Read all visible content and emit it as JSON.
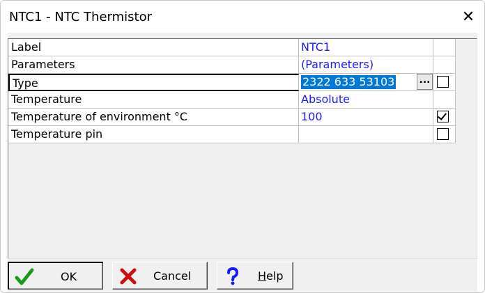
{
  "window": {
    "title": "NTC1 - NTC Thermistor",
    "close_glyph": "✕"
  },
  "properties": [
    {
      "name": "Label",
      "value": "NTC1",
      "checkbox": null
    },
    {
      "name": "Parameters",
      "value": "(Parameters)",
      "checkbox": null
    },
    {
      "name": "Type",
      "value": "2322 633 53103",
      "checkbox": false,
      "selected": true,
      "has_ellipsis": true
    },
    {
      "name": "Temperature",
      "value": "Absolute",
      "checkbox": null
    },
    {
      "name": "Temperature of environment °C",
      "value": "100",
      "checkbox": true
    },
    {
      "name": "Temperature pin",
      "value": "",
      "checkbox": false
    }
  ],
  "ellipsis_label": "...",
  "buttons": {
    "ok_label": "OK",
    "cancel_label": "Cancel",
    "help_label_prefix": "",
    "help_label_underlined": "H",
    "help_label_rest": "elp"
  },
  "colors": {
    "value_text": "#1a1aff",
    "selection": "#0078d7",
    "ok_icon": "#1a9a1a",
    "cancel_icon": "#cc1010",
    "help_icon": "#1a1aff"
  },
  "icons": {
    "ok": "checkmark-icon",
    "cancel": "x-icon",
    "help": "question-icon",
    "close": "close-icon"
  }
}
